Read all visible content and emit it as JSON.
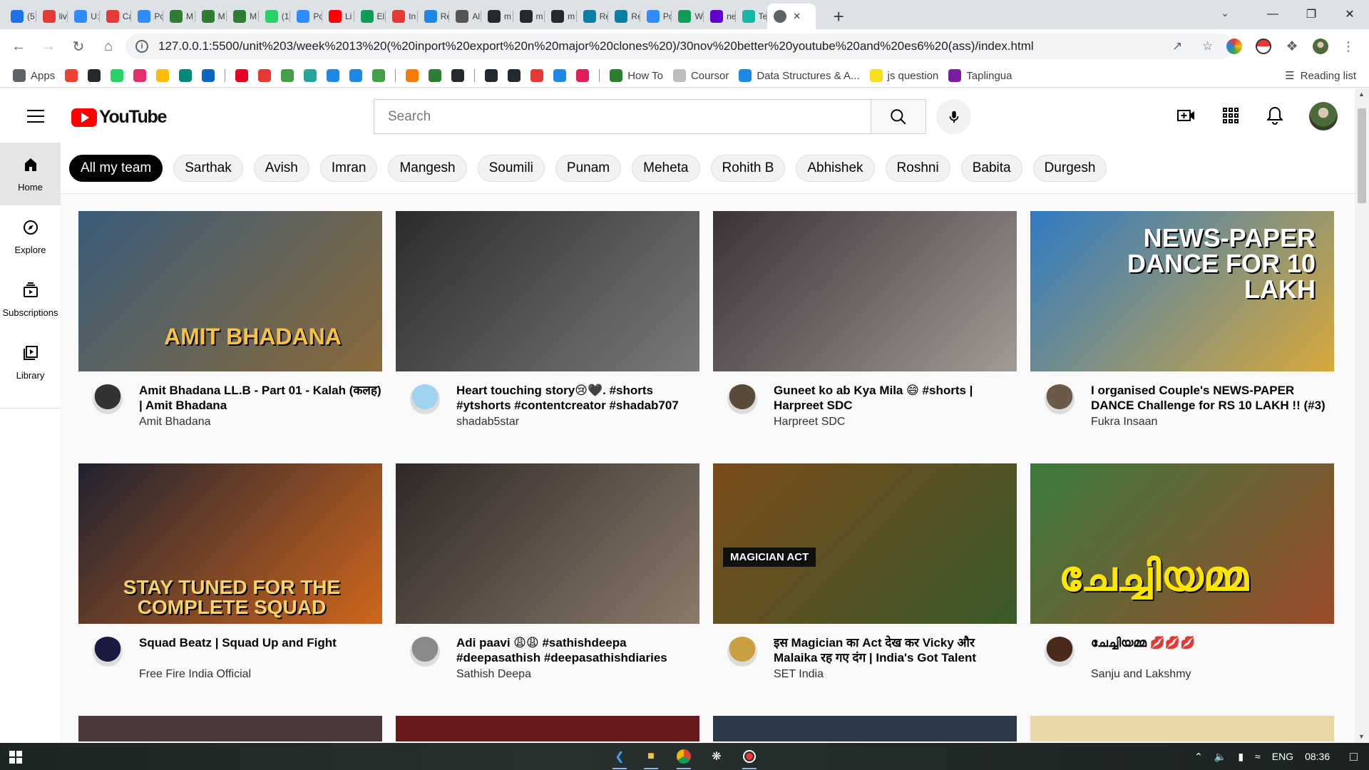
{
  "browser": {
    "tabs": [
      {
        "label": "(5",
        "icon": "mail-icon",
        "color": "#1a73e8"
      },
      {
        "label": "liv",
        "icon": "globe-icon",
        "color": "#e53935"
      },
      {
        "label": "U:",
        "icon": "zoom-icon",
        "color": "#2d8cff"
      },
      {
        "label": "Ca",
        "icon": "globe-icon",
        "color": "#e53935"
      },
      {
        "label": "Pc",
        "icon": "zoom-icon",
        "color": "#2d8cff"
      },
      {
        "label": "M",
        "icon": "pin-icon",
        "color": "#2e7d32"
      },
      {
        "label": "M",
        "icon": "pin-icon",
        "color": "#2e7d32"
      },
      {
        "label": "M",
        "icon": "pin-icon",
        "color": "#2e7d32"
      },
      {
        "label": "(1",
        "icon": "whatsapp-icon",
        "color": "#25d366"
      },
      {
        "label": "Pc",
        "icon": "zoom-icon",
        "color": "#2d8cff"
      },
      {
        "label": "Li",
        "icon": "youtube-icon",
        "color": "#ff0000"
      },
      {
        "label": "El",
        "icon": "plus-icon",
        "color": "#0f9d58"
      },
      {
        "label": "In",
        "icon": "globe-icon",
        "color": "#e53935"
      },
      {
        "label": "Re",
        "icon": "react-icon",
        "color": "#1e88e5"
      },
      {
        "label": "Al",
        "icon": "box-icon",
        "color": "#555555"
      },
      {
        "label": "m",
        "icon": "github-icon",
        "color": "#24292e"
      },
      {
        "label": "m",
        "icon": "github-icon",
        "color": "#24292e"
      },
      {
        "label": "m",
        "icon": "github-icon",
        "color": "#24292e"
      },
      {
        "label": "Re",
        "icon": "react-icon",
        "color": "#0a7ea4"
      },
      {
        "label": "Re",
        "icon": "react-icon",
        "color": "#0a7ea4"
      },
      {
        "label": "Pc",
        "icon": "zoom-icon",
        "color": "#2d8cff"
      },
      {
        "label": "W",
        "icon": "plus-icon",
        "color": "#0f9d58"
      },
      {
        "label": "ne",
        "icon": "yahoo-icon",
        "color": "#6001d2"
      },
      {
        "label": "Te",
        "icon": "diamond-icon",
        "color": "#13b8a6"
      }
    ],
    "active_tab": {
      "label": "",
      "icon": "globe-icon"
    },
    "url": "127.0.0.1:5500/unit%203/week%2013%20(%20inport%20export%20n%20major%20clones%20)/30nov%20better%20youtube%20and%20es6%20(ass)/index.html",
    "bookmarks": [
      {
        "label": "Apps",
        "icon": "apps-grid-icon",
        "color": "#5f6368"
      },
      {
        "label": "",
        "icon": "gmail-icon",
        "color": "#ea4335"
      },
      {
        "label": "",
        "icon": "github-icon",
        "color": "#24292e"
      },
      {
        "label": "",
        "icon": "whatsapp-icon",
        "color": "#25d366"
      },
      {
        "label": "",
        "icon": "instagram-icon",
        "color": "#e1306c"
      },
      {
        "label": "",
        "icon": "drive-icon",
        "color": "#fbbc04"
      },
      {
        "label": "",
        "icon": "meet-icon",
        "color": "#00897b"
      },
      {
        "label": "",
        "icon": "linkedin-icon",
        "color": "#0a66c2"
      },
      {
        "label": "",
        "icon": "pinterest-icon",
        "color": "#e60023"
      },
      {
        "label": "",
        "icon": "record-icon",
        "color": "#e53935"
      },
      {
        "label": "",
        "icon": "px-icon",
        "color": "#43a047"
      },
      {
        "label": "",
        "icon": "tool-icon",
        "color": "#26a69a"
      },
      {
        "label": "",
        "icon": "bug-icon",
        "color": "#1e88e5"
      },
      {
        "label": "",
        "icon": "flag-icon",
        "color": "#1e88e5"
      },
      {
        "label": "",
        "icon": "check-icon",
        "color": "#43a047"
      },
      {
        "label": "",
        "icon": "pma-icon",
        "color": "#f57c00"
      },
      {
        "label": "",
        "icon": "w-icon",
        "color": "#2e7d32"
      },
      {
        "label": "",
        "icon": "github-icon",
        "color": "#24292e"
      },
      {
        "label": "",
        "icon": "codepen-icon",
        "color": "#24292e"
      },
      {
        "label": "",
        "icon": "codewars-icon",
        "color": "#24292e"
      },
      {
        "label": "",
        "icon": "asterisk-icon",
        "color": "#e53935"
      },
      {
        "label": "",
        "icon": "diamond-icon",
        "color": "#1e88e5"
      },
      {
        "label": "",
        "icon": "slack-icon",
        "color": "#e01e5a"
      },
      {
        "label": "How To",
        "icon": "w-icon",
        "color": "#2e7d32"
      },
      {
        "label": "Coursor",
        "icon": "globe-icon",
        "color": "#bdbdbd"
      },
      {
        "label": "Data Structures & A...",
        "icon": "u-icon",
        "color": "#1e88e5"
      },
      {
        "label": "js question",
        "icon": "js-icon",
        "color": "#f7df1e"
      },
      {
        "label": "Taplingua",
        "icon": "star-icon",
        "color": "#7b1fa2"
      }
    ],
    "reading_list": "Reading list"
  },
  "youtube": {
    "logo_text": "YouTube",
    "search_placeholder": "Search",
    "sidebar": [
      {
        "label": "Home",
        "icon": "home-icon"
      },
      {
        "label": "Explore",
        "icon": "compass-icon"
      },
      {
        "label": "Subscriptions",
        "icon": "subscriptions-icon"
      },
      {
        "label": "Library",
        "icon": "library-icon"
      }
    ],
    "chips": [
      "All my team",
      "Sarthak",
      "Avish",
      "Imran",
      "Mangesh",
      "Soumili",
      "Punam",
      "Meheta",
      "Rohith B",
      "Abhishek",
      "Roshni",
      "Babita",
      "Durgesh"
    ],
    "videos": [
      {
        "title": "Amit Bhadana LL.B - Part 01 - Kalah (कलह) | Amit Bhadana",
        "channel": "Amit Bhadana",
        "thumb_text": "AMIT BHADANA",
        "thumb_colors": [
          "#3a5c7a",
          "#8a6a3a"
        ],
        "avatar_color": "#333333"
      },
      {
        "title": "Heart touching story😢🖤. #shorts #ytshorts #contentcreator #shadab707",
        "channel": "shadab5star",
        "thumb_text": "",
        "thumb_colors": [
          "#2b2b2b",
          "#7a7a78"
        ],
        "avatar_color": "#9fd3f0"
      },
      {
        "title": "Guneet ko ab Kya Mila 😄 #shorts | Harpreet SDC",
        "channel": "Harpreet SDC",
        "thumb_text": "",
        "thumb_colors": [
          "#3a3236",
          "#a29a94"
        ],
        "avatar_color": "#5a4a3a"
      },
      {
        "title": "I organised Couple's NEWS-PAPER DANCE Challenge for RS 10 LAKH !! (#3)",
        "channel": "Fukra Insaan",
        "thumb_text": "NEWS-PAPER DANCE FOR 10 LAKH",
        "thumb_colors": [
          "#2e7bc4",
          "#d8a83a"
        ],
        "avatar_color": "#6b5a4a"
      },
      {
        "title": "Squad Beatz | Squad Up and Fight",
        "channel": "Free Fire India Official",
        "thumb_text": "STAY TUNED FOR THE COMPLETE SQUAD",
        "thumb_colors": [
          "#1f2230",
          "#d0661c"
        ],
        "avatar_color": "#1a1a40"
      },
      {
        "title": "Adi paavi 😩😩 #sathishdeepa #deepasathish #deepasathishdiaries",
        "channel": "Sathish Deepa",
        "thumb_text": "",
        "thumb_colors": [
          "#2f2826",
          "#8a7a6a"
        ],
        "avatar_color": "#8a8a8a"
      },
      {
        "title": "इस Magician का Act देख कर Vicky और Malaika रह गए दंग | India's Got Talent",
        "channel": "SET India",
        "thumb_text": "MAGICIAN ACT",
        "thumb_colors": [
          "#7a4a1a",
          "#3a5a2a"
        ],
        "avatar_color": "#c8a040"
      },
      {
        "title": "ചേച്ചിയമ്മ 💋💋💋",
        "channel": "Sanju and Lakshmy",
        "thumb_text": "ചേച്ചിയമ്മ",
        "thumb_colors": [
          "#3a7a3a",
          "#9a4a2a"
        ],
        "avatar_color": "#4a2a1a"
      }
    ]
  },
  "taskbar": {
    "language": "ENG",
    "time": "08:36"
  }
}
